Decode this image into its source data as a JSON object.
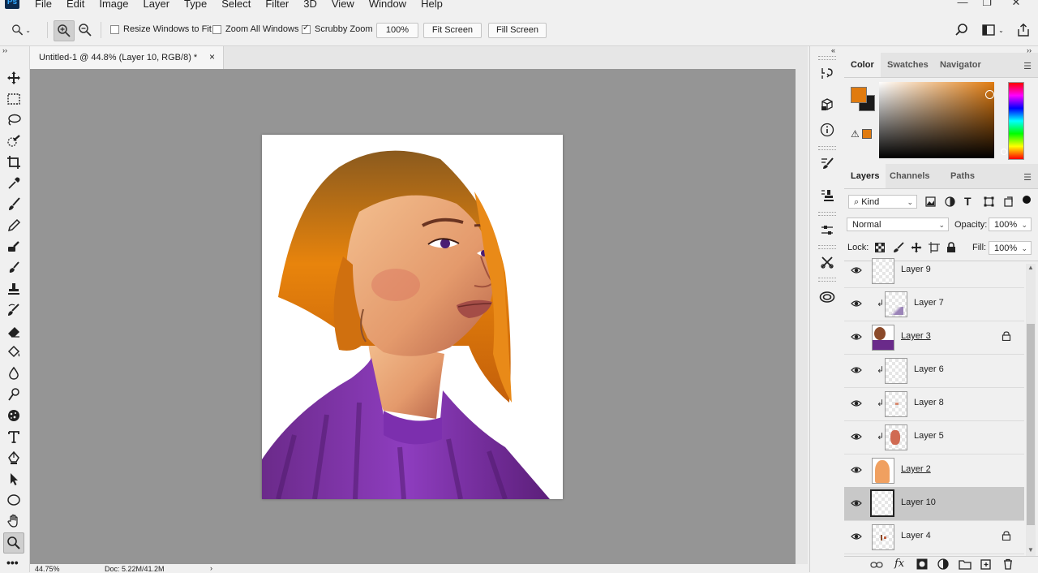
{
  "app": {
    "logo": "Ps",
    "menu": [
      "File",
      "Edit",
      "Image",
      "Layer",
      "Type",
      "Select",
      "Filter",
      "3D",
      "View",
      "Window",
      "Help"
    ],
    "window_controls": [
      "—",
      "❐",
      "✕"
    ]
  },
  "options": {
    "tool_icon": "zoom-icon",
    "resize_windows": {
      "label": "Resize Windows to Fit",
      "checked": false
    },
    "zoom_all": {
      "label": "Zoom All Windows",
      "checked": false
    },
    "scrubby": {
      "label": "Scrubby Zoom",
      "checked": true
    },
    "btn_100": "100%",
    "btn_fit": "Fit Screen",
    "btn_fill": "Fill Screen"
  },
  "document": {
    "tab_title": "Untitled-1 @ 44.8% (Layer 10, RGB/8) *",
    "close": "×",
    "status_zoom": "44.75%",
    "status_doc": "Doc: 5.22M/41.2M",
    "status_arrow": "›"
  },
  "color_panel": {
    "tabs": [
      "Color",
      "Swatches",
      "Navigator"
    ],
    "active_tab": "Color",
    "foreground": "#e07b0f",
    "background": "#1a1a1a"
  },
  "layers_panel": {
    "tabs": [
      "Layers",
      "Channels",
      "Paths"
    ],
    "active_tab": "Layers",
    "filter_kind": "Kind",
    "blend_mode": "Normal",
    "opacity_label": "Opacity:",
    "opacity_value": "100%",
    "lock_label": "Lock:",
    "fill_label": "Fill:",
    "fill_value": "100%",
    "layers": [
      {
        "name": "Layer 9",
        "clipped": false,
        "underline": false,
        "locked": false,
        "selected": false
      },
      {
        "name": "Layer 7",
        "clipped": true,
        "underline": false,
        "locked": false,
        "selected": false
      },
      {
        "name": "Layer 3",
        "clipped": false,
        "underline": true,
        "locked": true,
        "selected": false
      },
      {
        "name": "Layer 6",
        "clipped": true,
        "underline": false,
        "locked": false,
        "selected": false
      },
      {
        "name": "Layer 8",
        "clipped": true,
        "underline": false,
        "locked": false,
        "selected": false
      },
      {
        "name": "Layer 5",
        "clipped": true,
        "underline": false,
        "locked": false,
        "selected": false
      },
      {
        "name": "Layer 2",
        "clipped": false,
        "underline": true,
        "locked": false,
        "selected": false
      },
      {
        "name": "Layer 10",
        "clipped": false,
        "underline": false,
        "locked": false,
        "selected": true
      },
      {
        "name": "Layer 4",
        "clipped": false,
        "underline": false,
        "locked": true,
        "selected": false
      }
    ],
    "bottom_icons": [
      "link-icon",
      "fx-icon",
      "mask-icon",
      "adjustment-icon",
      "folder-icon",
      "new-layer-icon",
      "trash-icon"
    ],
    "fx_label": "fx"
  }
}
